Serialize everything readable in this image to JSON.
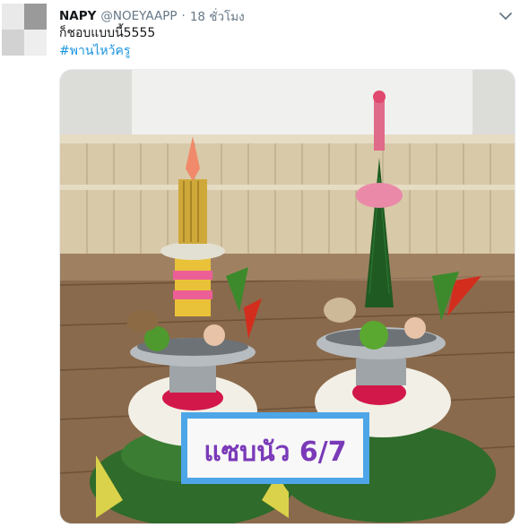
{
  "tweet": {
    "author_name": "NAPY",
    "author_handle": "@NOEYAAPP",
    "separator": "·",
    "timestamp": "18 ชั่วโมง",
    "text": "ก็ชอบแบบนี้5555",
    "hashtag": "#พานไหว้ครู"
  },
  "media": {
    "sign_text": "แซบนัว 6/7"
  },
  "icons": {
    "caret": "chevron-down-icon",
    "avatar": "avatar"
  },
  "colors": {
    "link": "#1b95e0",
    "text": "#14171a",
    "secondary": "#657786"
  }
}
